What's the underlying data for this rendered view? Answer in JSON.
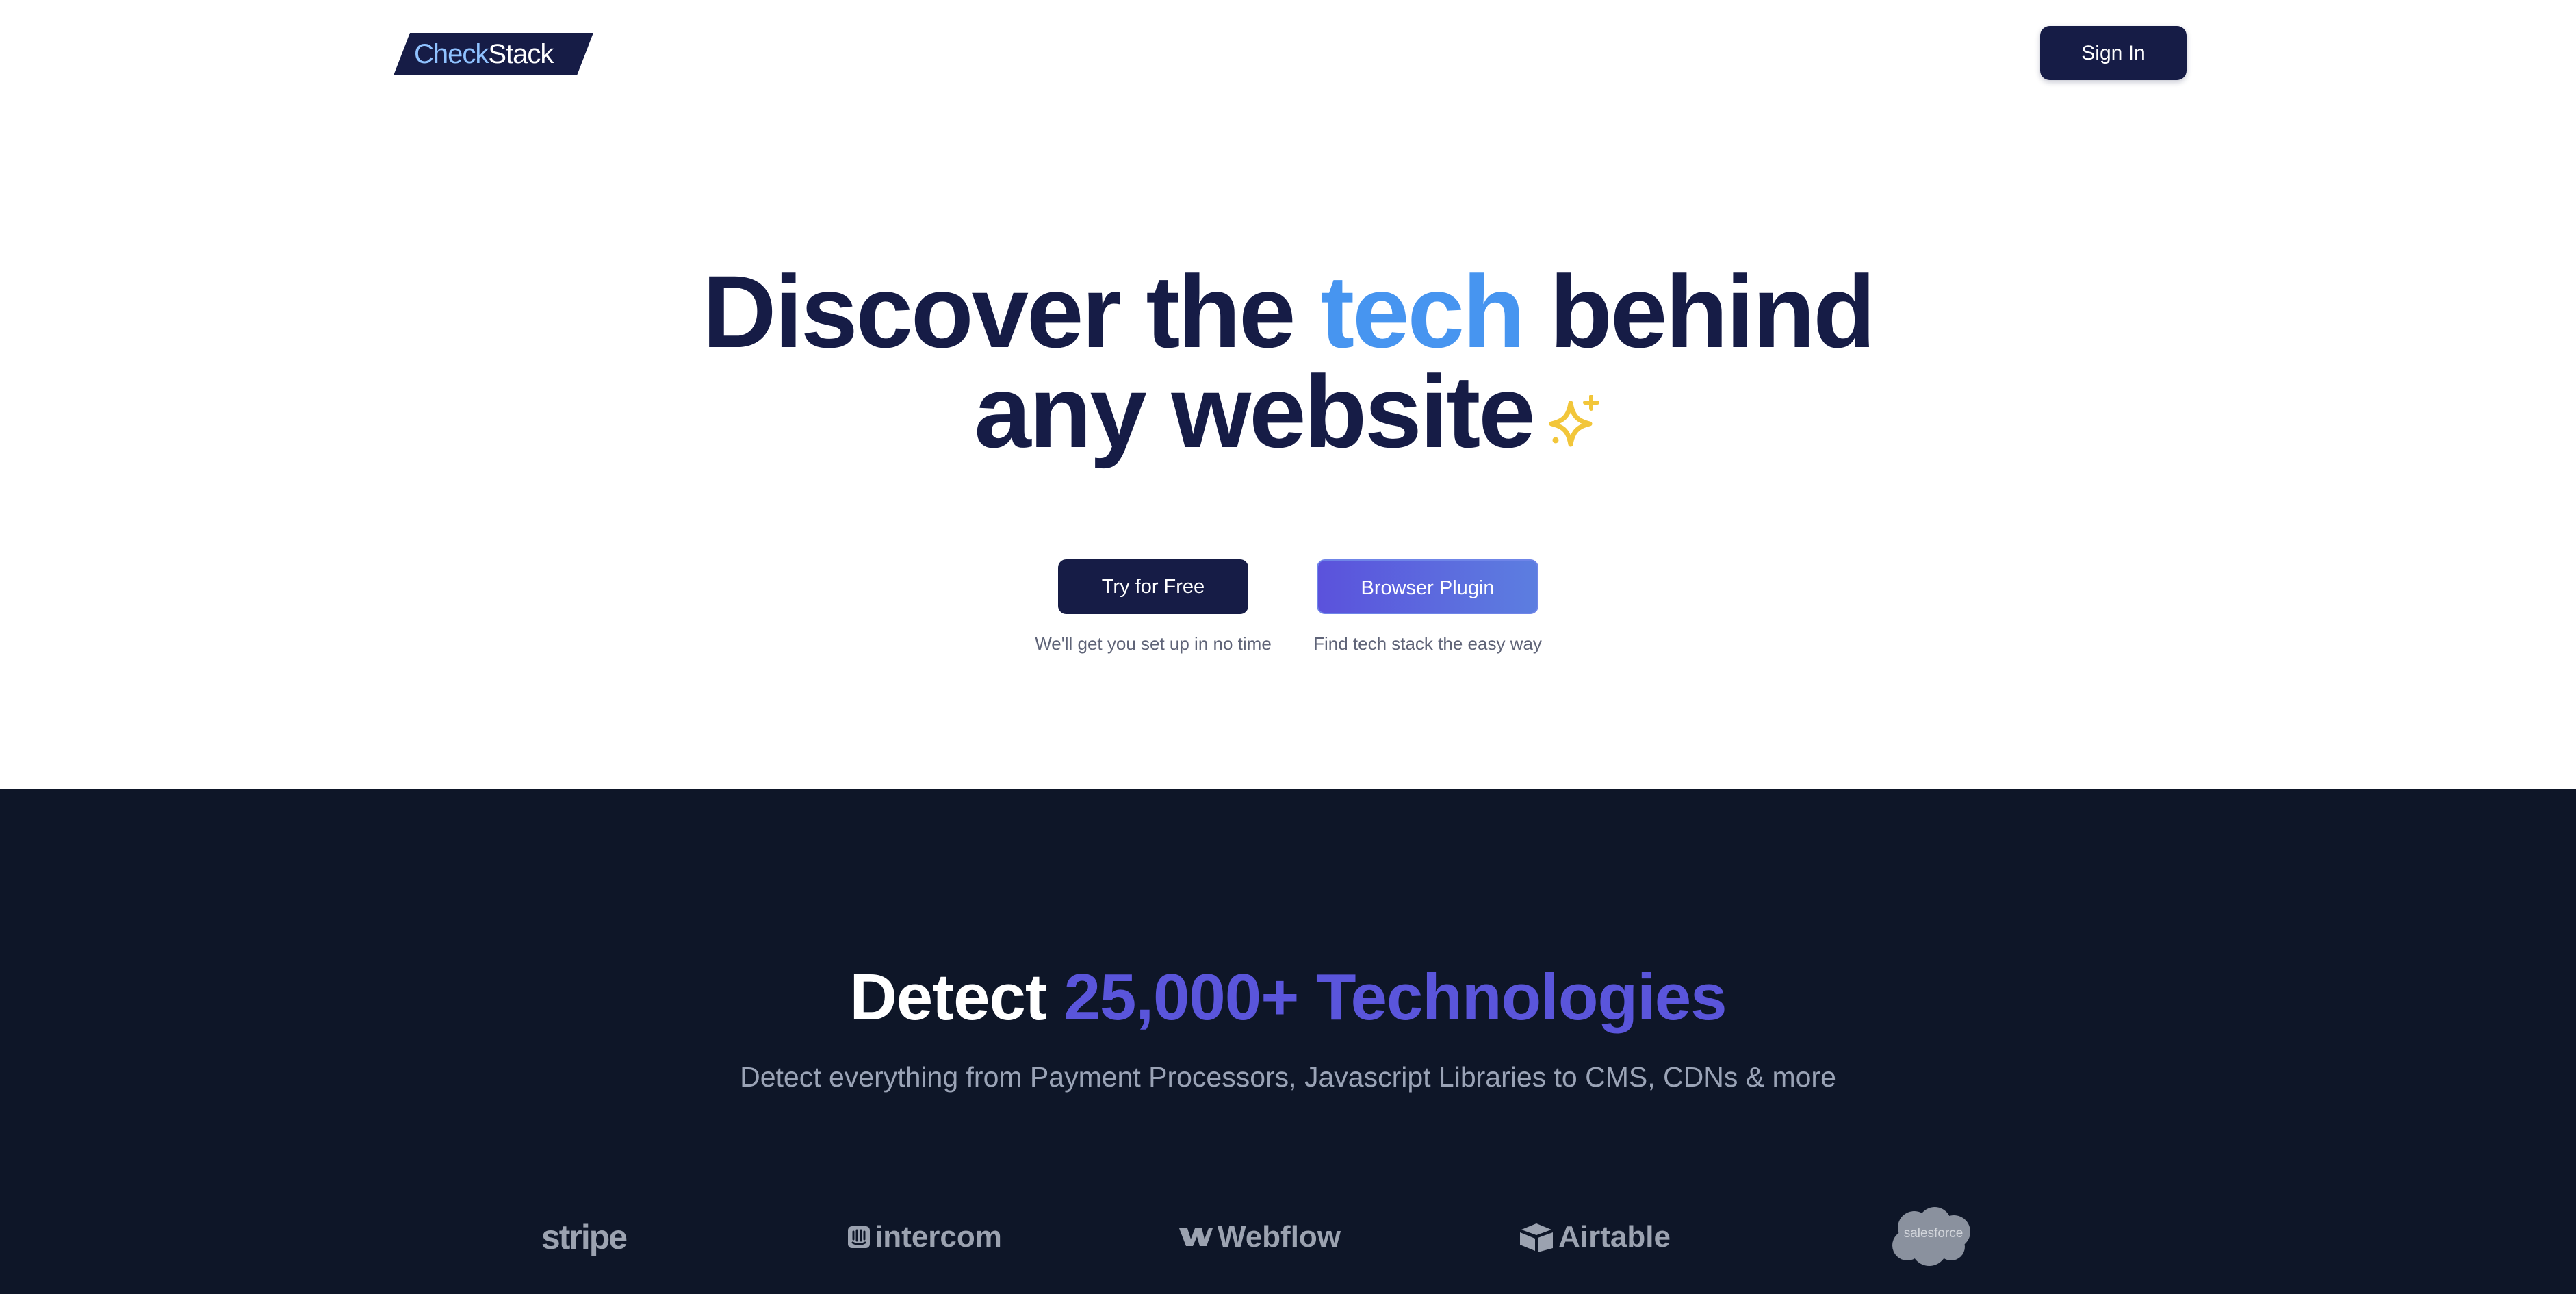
{
  "header": {
    "logo": {
      "part1": "Check",
      "part2": "Stack"
    },
    "signin_label": "Sign In"
  },
  "hero": {
    "title_part1": "Discover the ",
    "title_accent": "tech",
    "title_part2": " behind",
    "title_line2": "any website",
    "sparkle_icon": "sparkle-icon",
    "buttons": {
      "try_free": "Try for Free",
      "plugin": "Browser Plugin"
    },
    "notes": {
      "try_free": "We'll get you set up in no time",
      "plugin": "Find tech stack the easy way"
    }
  },
  "technologies": {
    "title_part1": "Detect ",
    "title_accent": "25,000+ Technologies",
    "subtitle": "Detect everything from Payment Processors, Javascript Libraries to CMS, CDNs & more",
    "brands": [
      "stripe",
      "intercom",
      "Webflow",
      "Airtable",
      "salesforce"
    ]
  },
  "colors": {
    "navy": "#161c46",
    "accent_blue": "#4795f0",
    "accent_purple": "#5a55db",
    "band_bg": "#0e1628",
    "sparkle": "#f2c63a",
    "logo_grey": "#9ba2b0"
  }
}
